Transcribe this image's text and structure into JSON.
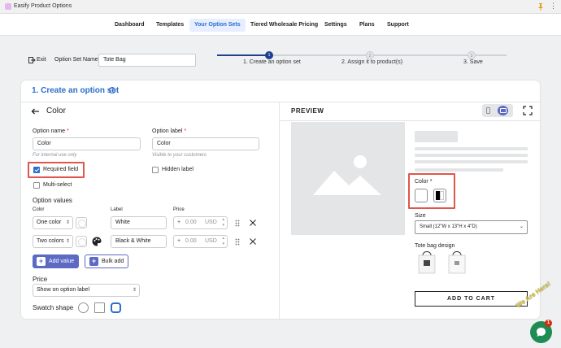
{
  "window": {
    "title": "Easify Product Options"
  },
  "nav": {
    "items": [
      "Dashboard",
      "Templates",
      "Your Option Sets",
      "Tiered Wholesale Pricing",
      "Settings",
      "Plans",
      "Support"
    ],
    "active_index": 2
  },
  "header": {
    "exit_label": "Exit",
    "option_set_name_label": "Option Set Name",
    "option_set_name_value": "Tote Bag"
  },
  "stepper": {
    "steps": [
      {
        "num": "1",
        "label": "1. Create an option set",
        "state": "active"
      },
      {
        "num": "2",
        "label": "2. Assign it to product(s)",
        "state": "pending"
      },
      {
        "num": "3",
        "label": "3. Save",
        "state": "pending"
      }
    ]
  },
  "card": {
    "title": "1. Create an option set",
    "section_title": "Color"
  },
  "form": {
    "option_name_label": "Option name",
    "option_name_value": "Color",
    "option_name_hint": "For internal use only",
    "option_label_label": "Option label",
    "option_label_value": "Color",
    "option_label_hint": "Visible to your customers",
    "required_field_label": "Required field",
    "required_field_checked": true,
    "hidden_label_label": "Hidden label",
    "multi_select_label": "Multi-select",
    "option_values_title": "Option values",
    "col_color": "Color",
    "col_label": "Label",
    "col_price": "Price",
    "values": [
      {
        "color_type": "One color",
        "label": "White",
        "price": "0.00",
        "currency": "USD"
      },
      {
        "color_type": "Two colors",
        "label": "Black & White",
        "price": "0.00",
        "currency": "USD"
      }
    ],
    "add_value_label": "Add value",
    "bulk_add_label": "Bulk add",
    "price_title": "Price",
    "price_display_value": "Show on option label",
    "swatch_shape_label": "Swatch shape"
  },
  "preview": {
    "title": "PREVIEW",
    "color_label": "Color",
    "size_label": "Size",
    "size_value": "Small (12\"W x 13\"H x 4\"D)",
    "tote_label": "Tote bag design",
    "add_to_cart": "ADD TO CART"
  },
  "chat": {
    "badge": "1",
    "tagline": "We Are Here!"
  },
  "colors": {
    "accent": "#2c6ecb",
    "primary_button": "#5c6ac4",
    "highlight": "#e0564c",
    "chat": "#1e8c54"
  }
}
